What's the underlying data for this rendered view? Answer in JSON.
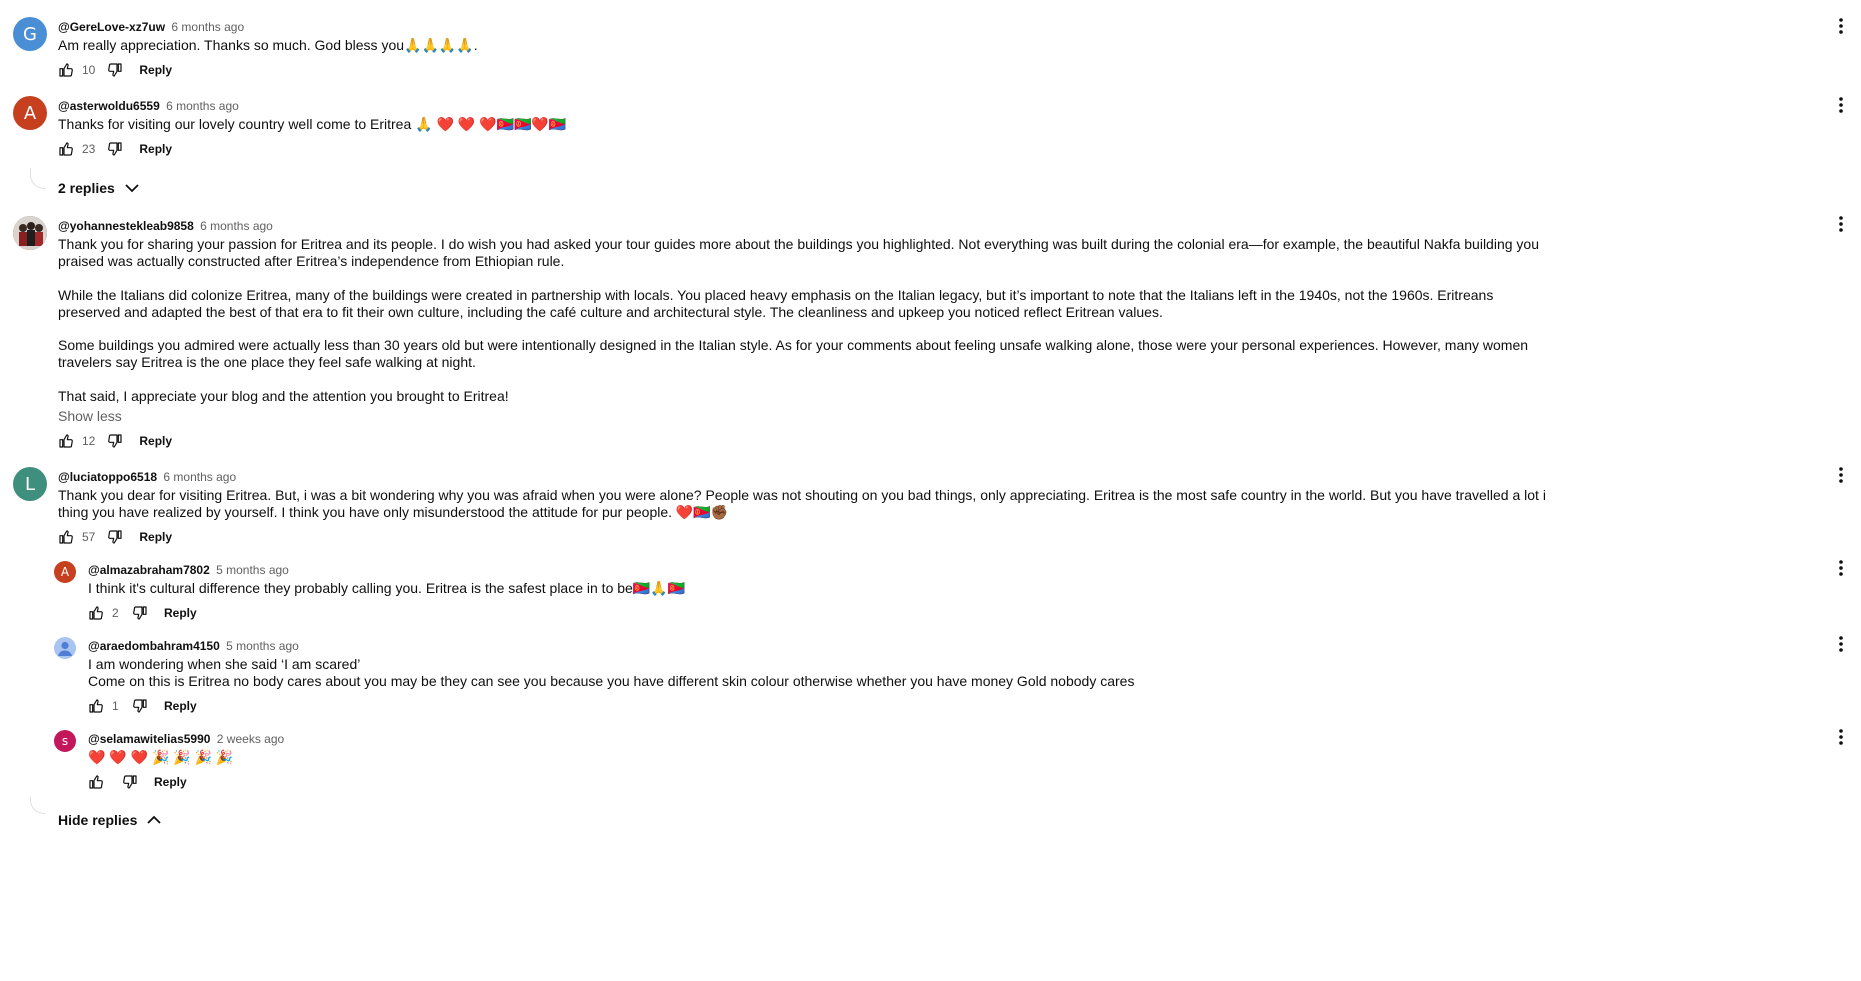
{
  "comments": [
    {
      "avatar_letter": "G",
      "avatar_color": "#4a8fd6",
      "author": "@GereLove-xz7uw",
      "time": "6 months ago",
      "text": "Am really appreciation. Thanks so much. God bless you🙏🙏🙏🙏.",
      "likes": "10",
      "reply_label": "Reply"
    },
    {
      "avatar_letter": "A",
      "avatar_color": "#c6401f",
      "author": "@asterwoldu6559",
      "time": "6 months ago",
      "text": "Thanks for visiting our lovely country well come to Eritrea 🙏 ❤️ ❤️ ❤️🇪🇷🇪🇷❤️🇪🇷",
      "likes": "23",
      "reply_label": "Reply",
      "replies_toggle": "2 replies"
    },
    {
      "author": "@yohannestekleab9858",
      "time": "6 months ago",
      "paragraphs": [
        "Thank you for sharing your passion for Eritrea and its people. I do wish you had asked your tour guides more about the buildings you highlighted. Not everything was built during the colonial era—for example, the beautiful Nakfa building you praised was actually constructed after Eritrea’s independence from Ethiopian rule.",
        "While the Italians did colonize Eritrea, many of the buildings were created in partnership with locals. You placed heavy emphasis on the Italian legacy, but it’s important to note that the Italians left in the 1940s, not the 1960s. Eritreans preserved and adapted the best of that era to fit their own culture, including the café culture and architectural style. The cleanliness and upkeep you noticed reflect Eritrean values.",
        "Some buildings you admired were actually less than 30 years old but were intentionally designed in the Italian style. As for your comments about feeling unsafe walking alone, those were your personal experiences. However, many women travelers say Eritrea is the one place they feel safe walking at night.",
        "That said, I appreciate your blog and the attention you brought to Eritrea!"
      ],
      "show_less": "Show less",
      "likes": "12",
      "reply_label": "Reply"
    },
    {
      "avatar_letter": "L",
      "avatar_color": "#3e8f7e",
      "author": "@luciatoppo6518",
      "time": "6 months ago",
      "text": "Thank you dear for visiting Eritrea. But, i was a bit wondering why you was afraid when you were alone? People was not shouting on you bad things, only appreciating. Eritrea is the most safe country in the world. But you have travelled a lot i thing you have realized by yourself. I think you have only misunderstood the attitude for pur people. ❤️🇪🇷✊🏾",
      "likes": "57",
      "reply_label": "Reply",
      "hide_replies": "Hide replies"
    }
  ],
  "replies": [
    {
      "avatar_letter": "A",
      "avatar_color": "#c6401f",
      "author": "@almazabraham7802",
      "time": "5 months ago",
      "text": "I think it's cultural difference they probably calling you. Eritrea is the safest place in to be🇪🇷🙏🇪🇷",
      "likes": "2",
      "reply_label": "Reply"
    },
    {
      "avatar_color": "#a9c4f0",
      "author": "@araedombahram4150",
      "time": "5 months ago",
      "text": "I am wondering when she said ‘I am scared’\nCome on this is Eritrea no body cares about you may be they can see you because you have different skin colour otherwise whether you have money Gold nobody cares",
      "likes": "1",
      "reply_label": "Reply"
    },
    {
      "avatar_letter": "s",
      "avatar_color": "#c2185b",
      "author": "@selamawitelias5990",
      "time": "2 weeks ago",
      "text": "❤️ ❤️ ❤️ 🎉 🎉 🎉 🎉",
      "likes": "",
      "reply_label": "Reply"
    }
  ],
  "icons": {
    "like": "thumbs-up-icon",
    "dislike": "thumbs-down-icon",
    "menu": "more-vert-icon",
    "chevron_down": "chevron-down-icon",
    "chevron_up": "chevron-up-icon"
  }
}
